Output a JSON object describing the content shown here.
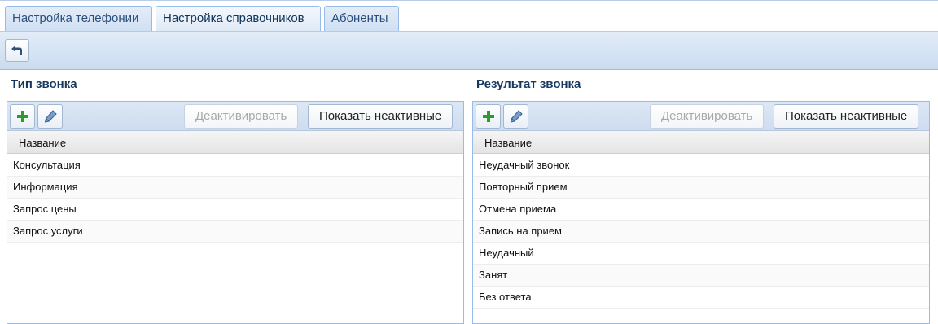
{
  "tabs": [
    {
      "label": "Настройка телефонии"
    },
    {
      "label": "Настройка справочников"
    },
    {
      "label": "Абоненты"
    }
  ],
  "active_tab": "Настройка справочников",
  "toolbar": {
    "back_icon": "back-arrow-icon"
  },
  "left_panel": {
    "title": "Тип звонка",
    "add_icon": "plus-icon",
    "edit_icon": "pencil-icon",
    "deactivate_label": "Деактивировать",
    "show_inactive_label": "Показать неактивные",
    "column_header": "Название",
    "rows": [
      "Консультация",
      "Информация",
      "Запрос цены",
      "Запрос услуги"
    ]
  },
  "right_panel": {
    "title": "Результат звонка",
    "add_icon": "plus-icon",
    "edit_icon": "pencil-icon",
    "deactivate_label": "Деактивировать",
    "show_inactive_label": "Показать неактивные",
    "column_header": "Название",
    "rows": [
      "Неудачный звонок",
      "Повторный прием",
      "Отмена приема",
      "Запись на прием",
      "Неудачный",
      "Занят",
      "Без ответа"
    ]
  },
  "colors": {
    "accent_border": "#99bbe8",
    "title_text": "#15385f",
    "add_icon": "#2e9a2e",
    "edit_icon": "#3c5f8f"
  }
}
